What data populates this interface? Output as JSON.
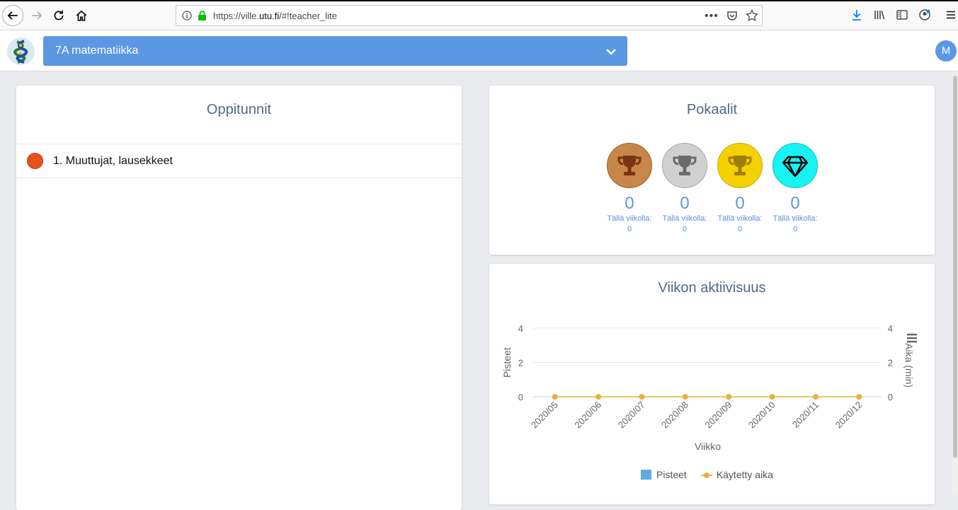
{
  "browser": {
    "url_prefix": "https://ville.",
    "url_domain": "utu.fi",
    "url_suffix": "/#!teacher_lite",
    "more_glyph": "•••"
  },
  "header": {
    "course_name": "7A matematiikka",
    "avatar_letter": "M"
  },
  "lessons": {
    "title": "Oppitunnit",
    "items": [
      {
        "label": "1. Muuttujat, lausekkeet",
        "status_color": "#e5531d"
      }
    ]
  },
  "trophies": {
    "title": "Pokaalit",
    "items": [
      {
        "name": "bronze",
        "count": "0",
        "week_label": "Tällä viikolla:",
        "week_count": "0",
        "color": "#c8864a",
        "cup_color": "#7a3410"
      },
      {
        "name": "silver",
        "count": "0",
        "week_label": "Tällä viikolla:",
        "week_count": "0",
        "color": "#d0d0d0",
        "cup_color": "#6b6b6b"
      },
      {
        "name": "gold",
        "count": "0",
        "week_label": "Tällä viikolla:",
        "week_count": "0",
        "color": "#f5d100",
        "cup_color": "#a07d08"
      },
      {
        "name": "diamond",
        "count": "0",
        "week_label": "Tällä viikolla:",
        "week_count": "0",
        "color": "#17f2f2",
        "cup_color": "#000000"
      }
    ]
  },
  "activity": {
    "title": "Viikon aktiivisuus",
    "legend_points": "Pisteet",
    "legend_time": "Käytetty aika"
  },
  "chart_data": {
    "type": "line",
    "title": "Viikon aktiivisuus",
    "xlabel": "Viikko",
    "ylabel": "Pisteet",
    "ylabel_right": "Aika (min)",
    "categories": [
      "2020/05",
      "2020/06",
      "2020/07",
      "2020/08",
      "2020/09",
      "2020/10",
      "2020/11",
      "2020/12"
    ],
    "ylim": [
      0,
      4
    ],
    "yticks": [
      0,
      2,
      4
    ],
    "series": [
      {
        "name": "Pisteet",
        "type": "bar",
        "color": "#5ea9e0",
        "values": [
          0,
          0,
          0,
          0,
          0,
          0,
          0,
          0
        ]
      },
      {
        "name": "Käytetty aika",
        "type": "line",
        "color": "#e3b341",
        "values": [
          0,
          0,
          0,
          0,
          0,
          0,
          0,
          0
        ]
      }
    ],
    "legend": "bottom",
    "grid": true
  }
}
